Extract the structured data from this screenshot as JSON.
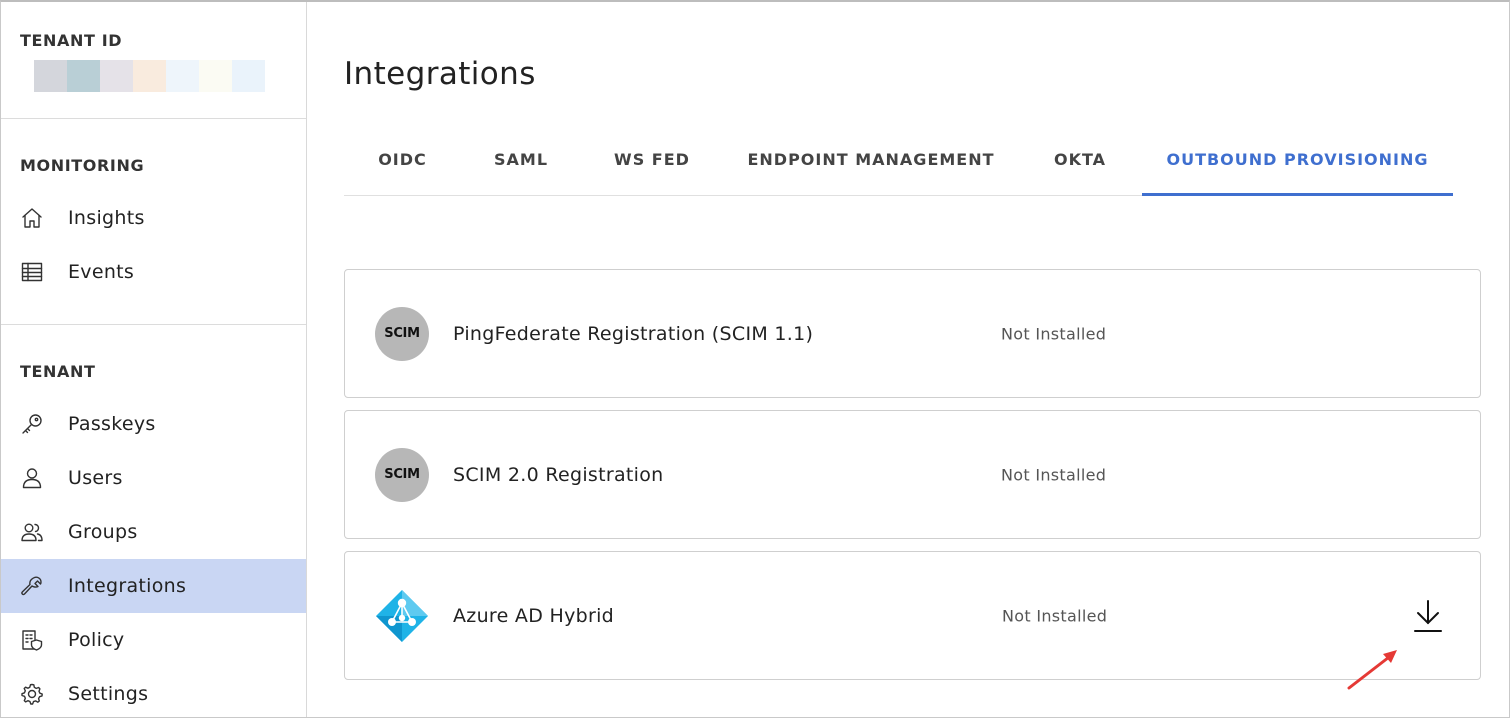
{
  "sidebar": {
    "tenant_heading": "TENANT ID",
    "tenant_swatch_colors": [
      "#d4d6dc",
      "#b9cfd6",
      "#e5e2e8",
      "#f9ebde",
      "#eef5fb",
      "#fbfbf3",
      "#eaf3fb"
    ],
    "monitoring_heading": "MONITORING",
    "monitoring_items": [
      {
        "label": "Insights",
        "icon": "home-icon"
      },
      {
        "label": "Events",
        "icon": "table-icon"
      }
    ],
    "tenant_section_heading": "TENANT",
    "tenant_items": [
      {
        "label": "Passkeys",
        "icon": "key-icon"
      },
      {
        "label": "Users",
        "icon": "user-icon"
      },
      {
        "label": "Groups",
        "icon": "group-icon"
      },
      {
        "label": "Integrations",
        "icon": "wrench-icon",
        "active": true
      },
      {
        "label": "Policy",
        "icon": "policy-icon"
      },
      {
        "label": "Settings",
        "icon": "gear-icon"
      }
    ],
    "active_color": "#c9d6f3"
  },
  "main": {
    "title": "Integrations",
    "tabs": [
      {
        "label": "OIDC"
      },
      {
        "label": "SAML"
      },
      {
        "label": "WS FED"
      },
      {
        "label": "ENDPOINT MANAGEMENT"
      },
      {
        "label": "OKTA"
      },
      {
        "label": "OUTBOUND PROVISIONING",
        "active": true
      }
    ],
    "accent_color": "#3f6fcf",
    "integrations": [
      {
        "logo_text": "SCIM",
        "name": "PingFederate Registration (SCIM 1.1)",
        "status": "Not Installed"
      },
      {
        "logo_text": "SCIM",
        "name": "SCIM 2.0 Registration",
        "status": "Not Installed"
      },
      {
        "logo_icon": "azure-ad-icon",
        "name": "Azure AD Hybrid",
        "status": "Not Installed",
        "action_icon": "download-icon"
      }
    ]
  }
}
